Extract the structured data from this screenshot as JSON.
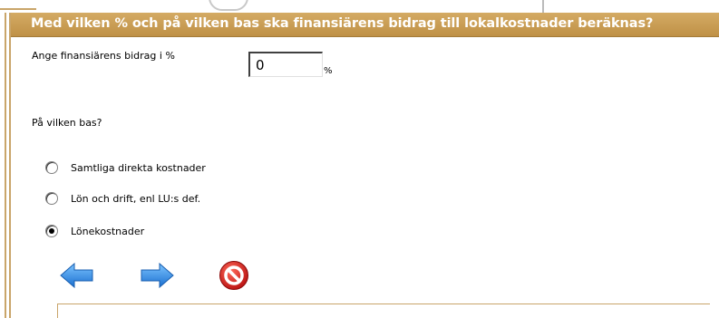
{
  "dialog": {
    "title": "Med vilken % och på vilken bas ska finansiärens bidrag till lokalkostnader beräknas?",
    "contribution_label": "Ange finansiärens bidrag i %",
    "contribution_value": "0",
    "percent_sign": "%",
    "basis_label": "På vilken bas?",
    "options": [
      {
        "label": "Samtliga direkta kostnader",
        "checked": false
      },
      {
        "label": "Lön och drift, enl LU:s def.",
        "checked": false
      },
      {
        "label": "Lönekostnader",
        "checked": true
      }
    ]
  },
  "icons": {
    "back": "arrow-left-icon",
    "forward": "arrow-right-icon",
    "cancel": "cancel-icon"
  },
  "colors": {
    "title_bar": "#c9a05a",
    "arrow_blue": "#2a8ae0",
    "cancel_red": "#d81e1e"
  }
}
